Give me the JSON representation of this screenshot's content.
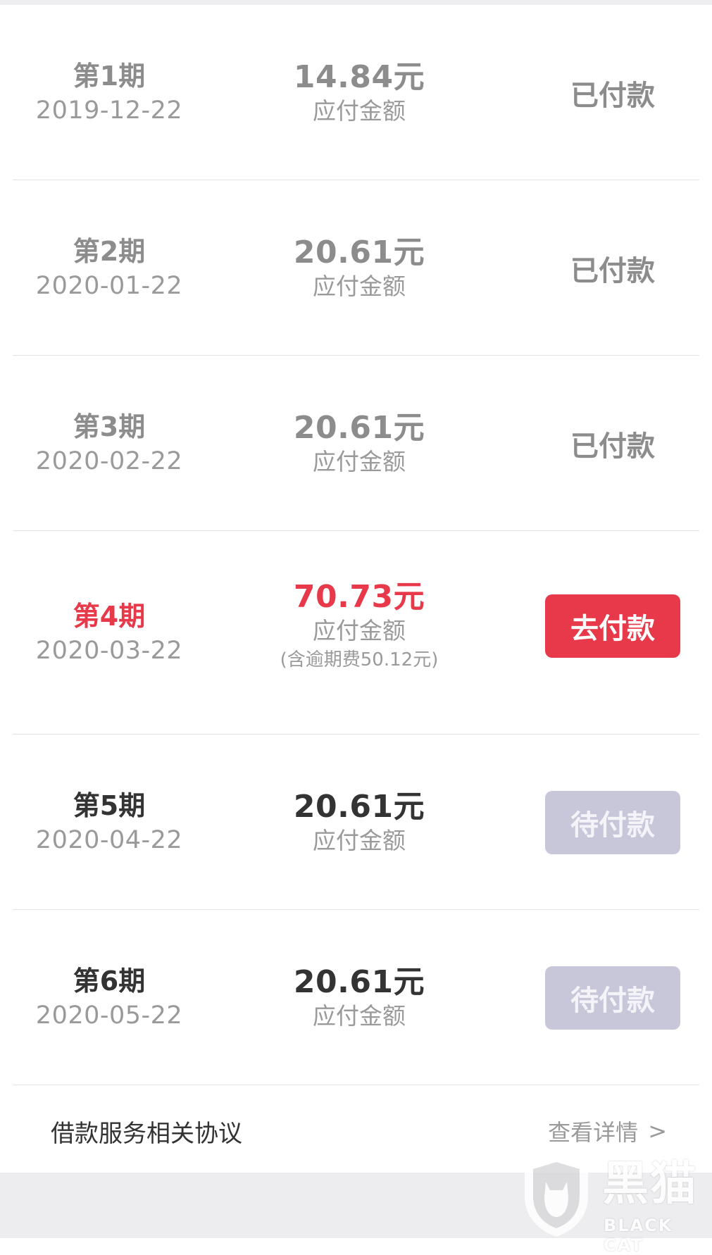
{
  "installments": [
    {
      "period": "第1期",
      "date": "2019-12-22",
      "amount": "14.84元",
      "amount_label": "应付金额",
      "note": "",
      "status": "已付款",
      "state": "paid"
    },
    {
      "period": "第2期",
      "date": "2020-01-22",
      "amount": "20.61元",
      "amount_label": "应付金额",
      "note": "",
      "status": "已付款",
      "state": "paid"
    },
    {
      "period": "第3期",
      "date": "2020-02-22",
      "amount": "20.61元",
      "amount_label": "应付金额",
      "note": "",
      "status": "已付款",
      "state": "paid"
    },
    {
      "period": "第4期",
      "date": "2020-03-22",
      "amount": "70.73元",
      "amount_label": "应付金额",
      "note": "(含逾期费50.12元)",
      "status": "去付款",
      "state": "due"
    },
    {
      "period": "第5期",
      "date": "2020-04-22",
      "amount": "20.61元",
      "amount_label": "应付金额",
      "note": "",
      "status": "待付款",
      "state": "pending"
    },
    {
      "period": "第6期",
      "date": "2020-05-22",
      "amount": "20.61元",
      "amount_label": "应付金额",
      "note": "",
      "status": "待付款",
      "state": "pending"
    }
  ],
  "footer": {
    "agreement_label": "借款服务相关协议",
    "details_link": "查看详情",
    "chevron": ">"
  },
  "watermark": {
    "name": "黑猫",
    "sub": "BLACK CAT",
    "icon": "black-cat-shield-logo"
  },
  "colors": {
    "accent_red": "#e8394a",
    "pending_button": "#c8c7d9",
    "muted_text": "#9a9a9a"
  }
}
